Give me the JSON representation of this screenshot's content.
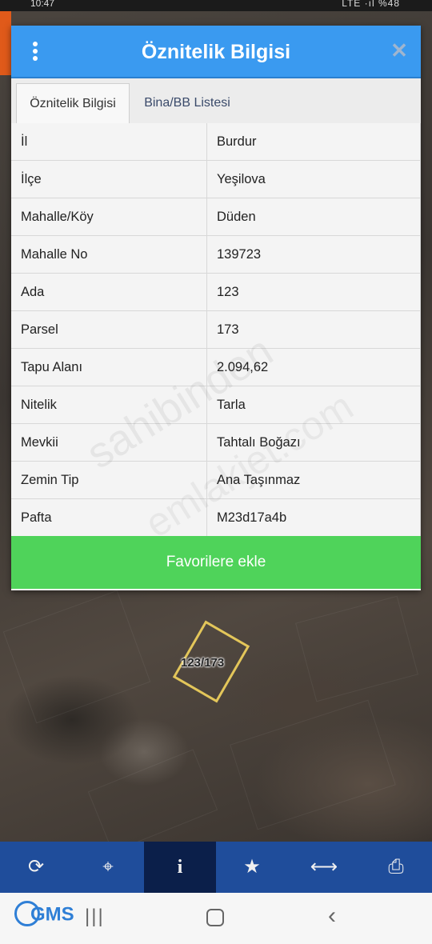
{
  "status_bar": {
    "time": "10:47",
    "right": "LTE ·ıl %48"
  },
  "dialog": {
    "title": "Öznitelik Bilgisi",
    "tabs": [
      {
        "label": "Öznitelik Bilgisi",
        "active": true
      },
      {
        "label": "Bina/BB Listesi",
        "active": false
      }
    ],
    "rows": [
      {
        "key": "İl",
        "value": "Burdur"
      },
      {
        "key": "İlçe",
        "value": "Yeşilova"
      },
      {
        "key": "Mahalle/Köy",
        "value": "Düden"
      },
      {
        "key": "Mahalle No",
        "value": "139723"
      },
      {
        "key": "Ada",
        "value": "123"
      },
      {
        "key": "Parsel",
        "value": "173"
      },
      {
        "key": "Tapu Alanı",
        "value": "2.094,62"
      },
      {
        "key": "Nitelik",
        "value": "Tarla"
      },
      {
        "key": "Mevkii",
        "value": "Tahtalı Boğazı"
      },
      {
        "key": "Zemin Tip",
        "value": "Ana Taşınmaz"
      },
      {
        "key": "Pafta",
        "value": "M23d17a4b"
      }
    ],
    "favorite_button": "Favorilere ekle"
  },
  "map": {
    "parcel_label": "123/173",
    "watermark_1": "sahibinden",
    "watermark_2": "emlakjet.com"
  },
  "toolbar": {
    "items": [
      {
        "icon": "refresh-icon",
        "glyph": "⟳"
      },
      {
        "icon": "locate-icon",
        "glyph": "⌖"
      },
      {
        "icon": "info-icon",
        "glyph": "i",
        "active": true
      },
      {
        "icon": "star-icon",
        "glyph": "★"
      },
      {
        "icon": "measure-icon",
        "glyph": "⟷"
      },
      {
        "icon": "print-icon",
        "glyph": "⎙"
      }
    ]
  },
  "nav": {
    "logo": "GMS"
  },
  "colors": {
    "header_blue": "#3a9af0",
    "favorite_green": "#4fd35a",
    "toolbar_blue": "#1f4d9b",
    "toolbar_active": "#0b1f4a",
    "parcel_outline": "#e3c65a"
  }
}
